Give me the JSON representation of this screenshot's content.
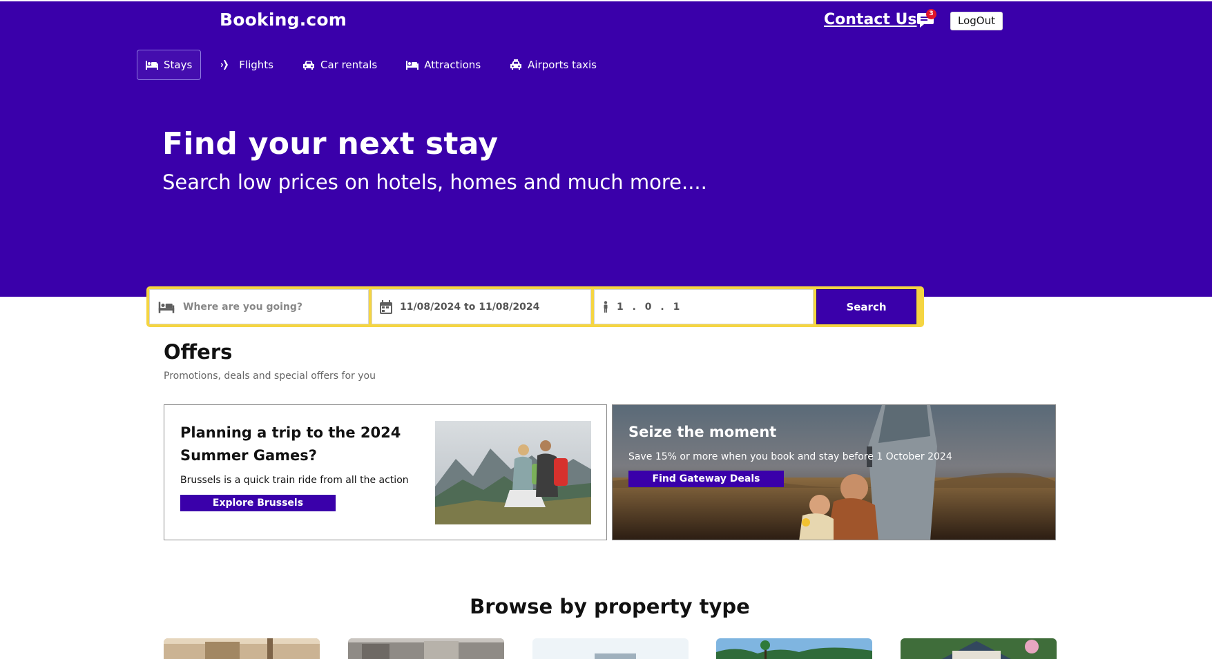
{
  "header": {
    "brand": "Booking.com",
    "contact_label": "Contact Us",
    "notification_count": "3",
    "logout_label": "LogOut"
  },
  "nav": {
    "items": [
      {
        "label": "Stays",
        "icon": "bed-icon",
        "active": true
      },
      {
        "label": "Flights",
        "icon": "plane-icon",
        "active": false
      },
      {
        "label": "Car rentals",
        "icon": "car-icon",
        "active": false
      },
      {
        "label": "Attractions",
        "icon": "attraction-icon",
        "active": false
      },
      {
        "label": "Airports taxis",
        "icon": "taxi-icon",
        "active": false
      }
    ]
  },
  "hero": {
    "title": "Find your next stay",
    "subtitle": "Search low prices on hotels, homes and much more...."
  },
  "search": {
    "destination_placeholder": "Where are you going?",
    "dates_value": "11/08/2024 to 11/08/2024",
    "guests_value": "1 . 0 . 1",
    "search_label": "Search"
  },
  "offers": {
    "title": "Offers",
    "subtitle": "Promotions, deals and special offers for you",
    "cards": [
      {
        "title": "Planning a trip to the 2024 Summer Games?",
        "description": "Brussels is a quick train ride from all the action",
        "button": "Explore Brussels"
      },
      {
        "title": "Seize the moment",
        "description": "Save 15% or more when you book and stay before 1 October 2024",
        "button": "Find Gateway Deals"
      }
    ]
  },
  "browse": {
    "title": "Browse by property type"
  },
  "colors": {
    "brand_purple": "#3a00aa",
    "search_border": "#f5d542",
    "badge_red": "#e0162b"
  }
}
